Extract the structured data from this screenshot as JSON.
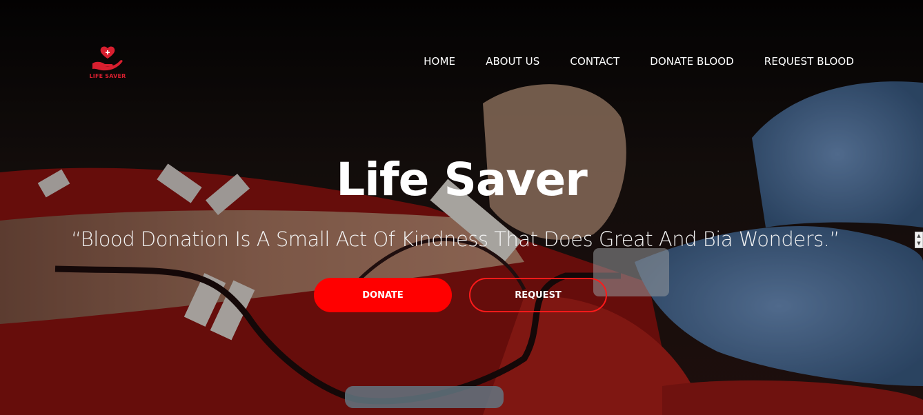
{
  "brand": {
    "logo_text": "LIFE SAVER",
    "icon": "hand-heart-icon",
    "color": "#d81f2f"
  },
  "nav": {
    "items": [
      {
        "label": "HOME"
      },
      {
        "label": "ABOUT US"
      },
      {
        "label": "CONTACT"
      },
      {
        "label": "DONATE BLOOD"
      },
      {
        "label": "REQUEST BLOOD"
      }
    ]
  },
  "hero": {
    "title": "Life Saver",
    "quote": "“Blood Donation Is A Small Act Of Kindness That Does Great And Bia Wonders.”",
    "donate_label": "DONATE",
    "request_label": "REQUEST"
  },
  "colors": {
    "accent": "#ff0000",
    "text": "#ffffff"
  },
  "scrollbar": {
    "up_icon": "chevron-up-icon",
    "down_icon": "chevron-down-icon"
  }
}
